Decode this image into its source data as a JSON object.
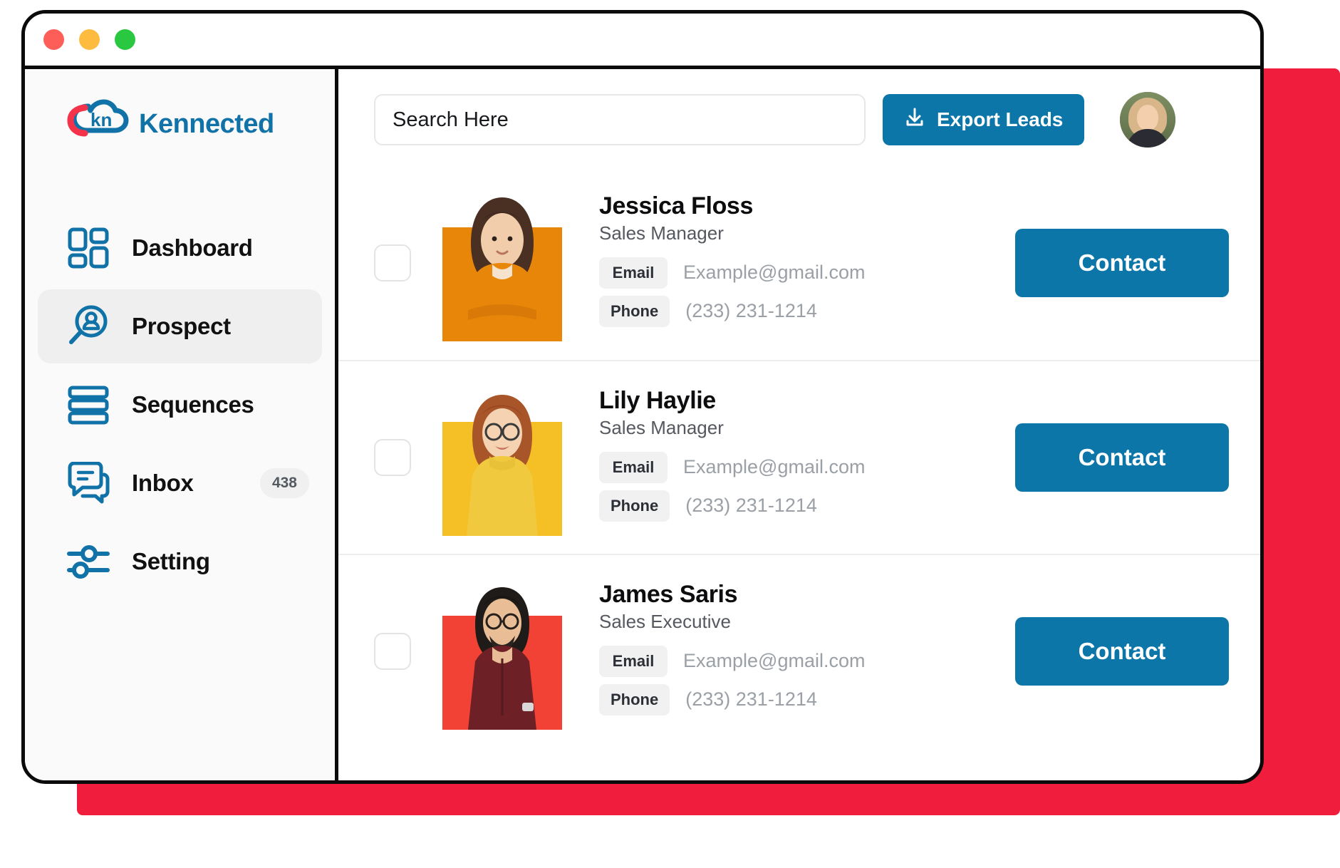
{
  "window": {
    "traffic_lights": [
      {
        "name": "close",
        "color": "#fd5e57"
      },
      {
        "name": "minimize",
        "color": "#fdbc40"
      },
      {
        "name": "maximize",
        "color": "#29c840"
      }
    ]
  },
  "theme": {
    "accent_blue": "#0c76a8",
    "backdrop_red": "#f01e3c",
    "sidebar_bg": "#fafafa",
    "active_item_bg": "#efefef"
  },
  "sidebar": {
    "brand": {
      "name": "Kennected",
      "mark_text": "kn"
    },
    "items": [
      {
        "label": "Dashboard",
        "icon": "grid-icon",
        "active": false,
        "badge": null
      },
      {
        "label": "Prospect",
        "icon": "person-search-icon",
        "active": true,
        "badge": null
      },
      {
        "label": "Sequences",
        "icon": "stacked-bars-icon",
        "active": false,
        "badge": null
      },
      {
        "label": "Inbox",
        "icon": "chat-bubbles-icon",
        "active": false,
        "badge": "438"
      },
      {
        "label": "Setting",
        "icon": "sliders-icon",
        "active": false,
        "badge": null
      }
    ]
  },
  "topbar": {
    "search": {
      "placeholder": "Search Here",
      "value": ""
    },
    "export_button": {
      "label": "Export Leads",
      "icon": "download-icon"
    },
    "avatar": {
      "name": "user-avatar"
    }
  },
  "labels": {
    "email": "Email",
    "phone": "Phone",
    "contact": "Contact"
  },
  "leads": [
    {
      "name": "Jessica Floss",
      "role": "Sales Manager",
      "email_label": "Email",
      "email": "Example@gmail.com",
      "phone_label": "Phone",
      "phone": "(233) 231-1214",
      "contact_label": "Contact",
      "swatch_color": "#e8860a",
      "selected": false
    },
    {
      "name": "Lily Haylie",
      "role": "Sales Manager",
      "email_label": "Email",
      "email": "Example@gmail.com",
      "phone_label": "Phone",
      "phone": "(233) 231-1214",
      "contact_label": "Contact",
      "swatch_color": "#f5c026",
      "selected": false
    },
    {
      "name": "James Saris",
      "role": "Sales Executive",
      "email_label": "Email",
      "email": "Example@gmail.com",
      "phone_label": "Phone",
      "phone": "(233) 231-1214",
      "contact_label": "Contact",
      "swatch_color": "#f24236",
      "selected": false
    }
  ]
}
